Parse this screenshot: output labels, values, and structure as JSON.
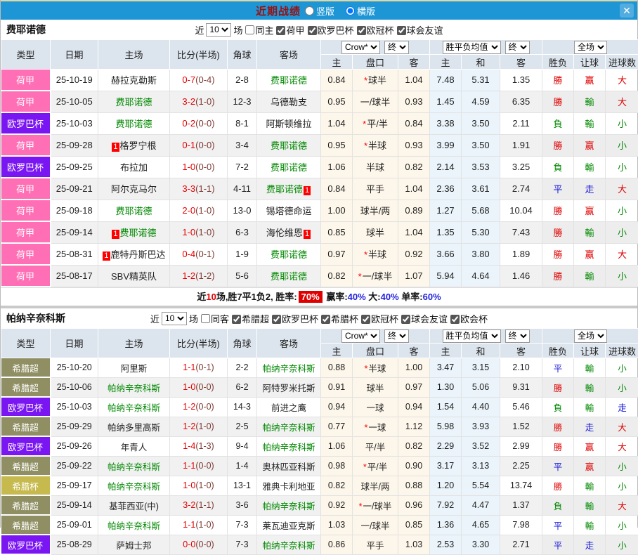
{
  "topbar": {
    "title": "近期战绩",
    "radio_vertical": "竖版",
    "radio_horizontal": "横版",
    "close": "✕"
  },
  "mark_text": "1",
  "type_colors": {
    "荷甲": "#ff6fb5",
    "欧罗巴杯": "#7a16f2",
    "希腊超": "#8f8f63",
    "希腊杯": "#c6ba4e"
  },
  "table_header": {
    "type": "类型",
    "date": "日期",
    "home": "主场",
    "score": "比分(半场)",
    "corner": "角球",
    "away": "客场",
    "odds_source": "Crow*",
    "final1": "终",
    "avg_label": "胜平负均值",
    "final2": "终",
    "fullmatch": "全场",
    "sub": {
      "home": "主",
      "handicap": "盘口",
      "away": "客",
      "avg_home": "主",
      "avg_draw": "和",
      "avg_away": "客",
      "wdl": "胜负",
      "let": "让球",
      "goals": "进球数"
    }
  },
  "sections": [
    {
      "team": "费耶诺德",
      "filters": {
        "near": "近",
        "count": "10",
        "unit": "场",
        "same": "同主",
        "same_checked": false,
        "leagues": [
          "荷甲",
          "欧罗巴杯",
          "欧冠杯",
          "球会友谊"
        ]
      },
      "rows": [
        {
          "lg": "荷甲",
          "d": "25-10-19",
          "h": "赫拉克勒斯",
          "hg": 0,
          "hm": 0,
          "ft": "0-7",
          "ht": "(0-4)",
          "cr": "2-8",
          "a": "费耶诺德",
          "ag": 1,
          "am": 0,
          "o1": "0.84",
          "st": 1,
          "hc": "球半",
          "o2": "1.04",
          "m1": "7.48",
          "m2": "5.31",
          "m3": "1.35",
          "r1": [
            "勝",
            "r"
          ],
          "r2": [
            "赢",
            "r"
          ],
          "r3": [
            "大",
            "r"
          ]
        },
        {
          "lg": "荷甲",
          "d": "25-10-05",
          "h": "费耶诺德",
          "hg": 1,
          "hm": 0,
          "ft": "3-2",
          "ht": "(1-0)",
          "cr": "12-3",
          "a": "乌德勒支",
          "ag": 0,
          "am": 0,
          "o1": "0.95",
          "st": 0,
          "hc": "一/球半",
          "o2": "0.93",
          "m1": "1.45",
          "m2": "4.59",
          "m3": "6.35",
          "r1": [
            "勝",
            "r"
          ],
          "r2": [
            "輸",
            "g"
          ],
          "r3": [
            "大",
            "r"
          ]
        },
        {
          "lg": "欧罗巴杯",
          "d": "25-10-03",
          "h": "费耶诺德",
          "hg": 1,
          "hm": 0,
          "ft": "0-2",
          "ht": "(0-0)",
          "cr": "8-1",
          "a": "阿斯顿维拉",
          "ag": 0,
          "am": 0,
          "o1": "1.04",
          "st": 1,
          "hc": "平/半",
          "o2": "0.84",
          "m1": "3.38",
          "m2": "3.50",
          "m3": "2.11",
          "r1": [
            "負",
            "g"
          ],
          "r2": [
            "輸",
            "g"
          ],
          "r3": [
            "小",
            "g"
          ]
        },
        {
          "lg": "荷甲",
          "d": "25-09-28",
          "h": "格罗宁根",
          "hg": 0,
          "hm": 1,
          "ft": "0-1",
          "ht": "(0-0)",
          "cr": "3-4",
          "a": "费耶诺德",
          "ag": 1,
          "am": 0,
          "o1": "0.95",
          "st": 1,
          "hc": "半球",
          "o2": "0.93",
          "m1": "3.99",
          "m2": "3.50",
          "m3": "1.91",
          "r1": [
            "勝",
            "r"
          ],
          "r2": [
            "赢",
            "r"
          ],
          "r3": [
            "小",
            "g"
          ]
        },
        {
          "lg": "欧罗巴杯",
          "d": "25-09-25",
          "h": "布拉加",
          "hg": 0,
          "hm": 0,
          "ft": "1-0",
          "ht": "(0-0)",
          "cr": "7-2",
          "a": "费耶诺德",
          "ag": 1,
          "am": 0,
          "o1": "1.06",
          "st": 0,
          "hc": "半球",
          "o2": "0.82",
          "m1": "2.14",
          "m2": "3.53",
          "m3": "3.25",
          "r1": [
            "負",
            "g"
          ],
          "r2": [
            "輸",
            "g"
          ],
          "r3": [
            "小",
            "g"
          ]
        },
        {
          "lg": "荷甲",
          "d": "25-09-21",
          "h": "阿尔克马尔",
          "hg": 0,
          "hm": 0,
          "ft": "3-3",
          "ht": "(1-1)",
          "cr": "4-11",
          "a": "费耶诺德",
          "ag": 1,
          "am": 1,
          "o1": "0.84",
          "st": 0,
          "hc": "平手",
          "o2": "1.04",
          "m1": "2.36",
          "m2": "3.61",
          "m3": "2.74",
          "r1": [
            "平",
            "b"
          ],
          "r2": [
            "走",
            "b"
          ],
          "r3": [
            "大",
            "r"
          ]
        },
        {
          "lg": "荷甲",
          "d": "25-09-18",
          "h": "费耶诺德",
          "hg": 1,
          "hm": 0,
          "ft": "2-0",
          "ht": "(1-0)",
          "cr": "13-0",
          "a": "锡塔德命运",
          "ag": 0,
          "am": 0,
          "o1": "1.00",
          "st": 0,
          "hc": "球半/两",
          "o2": "0.89",
          "m1": "1.27",
          "m2": "5.68",
          "m3": "10.04",
          "r1": [
            "勝",
            "r"
          ],
          "r2": [
            "赢",
            "r"
          ],
          "r3": [
            "小",
            "g"
          ]
        },
        {
          "lg": "荷甲",
          "d": "25-09-14",
          "h": "费耶诺德",
          "hg": 1,
          "hm": 1,
          "ft": "1-0",
          "ht": "(1-0)",
          "cr": "6-3",
          "a": "海伦维恩",
          "ag": 0,
          "am": 1,
          "o1": "0.85",
          "st": 0,
          "hc": "球半",
          "o2": "1.04",
          "m1": "1.35",
          "m2": "5.30",
          "m3": "7.43",
          "r1": [
            "勝",
            "r"
          ],
          "r2": [
            "輸",
            "g"
          ],
          "r3": [
            "小",
            "g"
          ]
        },
        {
          "lg": "荷甲",
          "d": "25-08-31",
          "h": "鹿特丹斯巴达",
          "hg": 0,
          "hm": 1,
          "ft": "0-4",
          "ht": "(0-1)",
          "cr": "1-9",
          "a": "费耶诺德",
          "ag": 1,
          "am": 0,
          "o1": "0.97",
          "st": 1,
          "hc": "半球",
          "o2": "0.92",
          "m1": "3.66",
          "m2": "3.80",
          "m3": "1.89",
          "r1": [
            "勝",
            "r"
          ],
          "r2": [
            "赢",
            "r"
          ],
          "r3": [
            "大",
            "r"
          ]
        },
        {
          "lg": "荷甲",
          "d": "25-08-17",
          "h": "SBV精英队",
          "hg": 0,
          "hm": 0,
          "ft": "1-2",
          "ht": "(1-2)",
          "cr": "5-6",
          "a": "费耶诺德",
          "ag": 1,
          "am": 0,
          "o1": "0.82",
          "st": 1,
          "hc": "一/球半",
          "o2": "1.07",
          "m1": "5.94",
          "m2": "4.64",
          "m3": "1.46",
          "r1": [
            "勝",
            "r"
          ],
          "r2": [
            "輸",
            "g"
          ],
          "r3": [
            "小",
            "g"
          ]
        }
      ],
      "summary": [
        {
          "text": "近",
          "style": "k"
        },
        {
          "text": "10",
          "style": "r"
        },
        {
          "text": "场,胜7平1负2, 胜率:",
          "style": "k"
        },
        {
          "text": "70%",
          "style": "rb"
        },
        {
          "text": " 赢率:",
          "style": "k"
        },
        {
          "text": "40%",
          "style": "b"
        },
        {
          "text": " 大:",
          "style": "k"
        },
        {
          "text": "40%",
          "style": "b"
        },
        {
          "text": " 单率:",
          "style": "k"
        },
        {
          "text": "60%",
          "style": "b"
        }
      ]
    },
    {
      "team": "帕纳辛奈科斯",
      "filters": {
        "near": "近",
        "count": "10",
        "unit": "场",
        "same": "同客",
        "same_checked": false,
        "leagues": [
          "希腊超",
          "欧罗巴杯",
          "希腊杯",
          "欧冠杯",
          "球会友谊",
          "欧会杯"
        ]
      },
      "rows": [
        {
          "lg": "希腊超",
          "d": "25-10-20",
          "h": "阿里斯",
          "hg": 0,
          "hm": 0,
          "ft": "1-1",
          "ht": "(0-1)",
          "cr": "2-2",
          "a": "帕纳辛奈科斯",
          "ag": 1,
          "am": 0,
          "o1": "0.88",
          "st": 1,
          "hc": "半球",
          "o2": "1.00",
          "m1": "3.47",
          "m2": "3.15",
          "m3": "2.10",
          "r1": [
            "平",
            "b"
          ],
          "r2": [
            "輸",
            "g"
          ],
          "r3": [
            "小",
            "g"
          ]
        },
        {
          "lg": "希腊超",
          "d": "25-10-06",
          "h": "帕纳辛奈科斯",
          "hg": 1,
          "hm": 0,
          "ft": "1-0",
          "ht": "(0-0)",
          "cr": "6-2",
          "a": "阿特罗米托斯",
          "ag": 0,
          "am": 0,
          "o1": "0.91",
          "st": 0,
          "hc": "球半",
          "o2": "0.97",
          "m1": "1.30",
          "m2": "5.06",
          "m3": "9.31",
          "r1": [
            "勝",
            "r"
          ],
          "r2": [
            "輸",
            "g"
          ],
          "r3": [
            "小",
            "g"
          ]
        },
        {
          "lg": "欧罗巴杯",
          "d": "25-10-03",
          "h": "帕纳辛奈科斯",
          "hg": 1,
          "hm": 0,
          "ft": "1-2",
          "ht": "(0-0)",
          "cr": "14-3",
          "a": "前进之鹰",
          "ag": 0,
          "am": 0,
          "o1": "0.94",
          "st": 0,
          "hc": "一球",
          "o2": "0.94",
          "m1": "1.54",
          "m2": "4.40",
          "m3": "5.46",
          "r1": [
            "負",
            "g"
          ],
          "r2": [
            "輸",
            "g"
          ],
          "r3": [
            "走",
            "b"
          ]
        },
        {
          "lg": "希腊超",
          "d": "25-09-29",
          "h": "帕纳多里高斯",
          "hg": 0,
          "hm": 0,
          "ft": "1-2",
          "ht": "(1-0)",
          "cr": "2-5",
          "a": "帕纳辛奈科斯",
          "ag": 1,
          "am": 0,
          "o1": "0.77",
          "st": 1,
          "hc": "一球",
          "o2": "1.12",
          "m1": "5.98",
          "m2": "3.93",
          "m3": "1.52",
          "r1": [
            "勝",
            "r"
          ],
          "r2": [
            "走",
            "b"
          ],
          "r3": [
            "大",
            "r"
          ]
        },
        {
          "lg": "欧罗巴杯",
          "d": "25-09-26",
          "h": "年青人",
          "hg": 0,
          "hm": 0,
          "ft": "1-4",
          "ht": "(1-3)",
          "cr": "9-4",
          "a": "帕纳辛奈科斯",
          "ag": 1,
          "am": 0,
          "o1": "1.06",
          "st": 0,
          "hc": "平/半",
          "o2": "0.82",
          "m1": "2.29",
          "m2": "3.52",
          "m3": "2.99",
          "r1": [
            "勝",
            "r"
          ],
          "r2": [
            "赢",
            "r"
          ],
          "r3": [
            "大",
            "r"
          ]
        },
        {
          "lg": "希腊超",
          "d": "25-09-22",
          "h": "帕纳辛奈科斯",
          "hg": 1,
          "hm": 0,
          "ft": "1-1",
          "ht": "(0-0)",
          "cr": "1-4",
          "a": "奥林匹亚科斯",
          "ag": 0,
          "am": 0,
          "o1": "0.98",
          "st": 1,
          "hc": "平/半",
          "o2": "0.90",
          "m1": "3.17",
          "m2": "3.13",
          "m3": "2.25",
          "r1": [
            "平",
            "b"
          ],
          "r2": [
            "赢",
            "r"
          ],
          "r3": [
            "小",
            "g"
          ]
        },
        {
          "lg": "希腊杯",
          "d": "25-09-17",
          "h": "帕纳辛奈科斯",
          "hg": 1,
          "hm": 0,
          "ft": "1-0",
          "ht": "(1-0)",
          "cr": "13-1",
          "a": "雅典卡利地亚",
          "ag": 0,
          "am": 0,
          "o1": "0.82",
          "st": 0,
          "hc": "球半/两",
          "o2": "0.88",
          "m1": "1.20",
          "m2": "5.54",
          "m3": "13.74",
          "r1": [
            "勝",
            "r"
          ],
          "r2": [
            "輸",
            "g"
          ],
          "r3": [
            "小",
            "g"
          ]
        },
        {
          "lg": "希腊超",
          "d": "25-09-14",
          "h": "基菲西亚(中)",
          "hg": 0,
          "hm": 0,
          "ft": "3-2",
          "ht": "(1-1)",
          "cr": "3-6",
          "a": "帕纳辛奈科斯",
          "ag": 1,
          "am": 0,
          "o1": "0.92",
          "st": 1,
          "hc": "一/球半",
          "o2": "0.96",
          "m1": "7.92",
          "m2": "4.47",
          "m3": "1.37",
          "r1": [
            "負",
            "g"
          ],
          "r2": [
            "輸",
            "g"
          ],
          "r3": [
            "大",
            "r"
          ]
        },
        {
          "lg": "希腊超",
          "d": "25-09-01",
          "h": "帕纳辛奈科斯",
          "hg": 1,
          "hm": 0,
          "ft": "1-1",
          "ht": "(1-0)",
          "cr": "7-3",
          "a": "莱瓦迪亚克斯",
          "ag": 0,
          "am": 0,
          "o1": "1.03",
          "st": 0,
          "hc": "一/球半",
          "o2": "0.85",
          "m1": "1.36",
          "m2": "4.65",
          "m3": "7.98",
          "r1": [
            "平",
            "b"
          ],
          "r2": [
            "輸",
            "g"
          ],
          "r3": [
            "小",
            "g"
          ]
        },
        {
          "lg": "欧罗巴杯",
          "d": "25-08-29",
          "h": "萨姆士邦",
          "hg": 0,
          "hm": 0,
          "ft": "0-0",
          "ht": "(0-0)",
          "cr": "7-3",
          "a": "帕纳辛奈科斯",
          "ag": 1,
          "am": 0,
          "o1": "0.86",
          "st": 0,
          "hc": "平手",
          "o2": "1.03",
          "m1": "2.53",
          "m2": "3.30",
          "m3": "2.71",
          "r1": [
            "平",
            "b"
          ],
          "r2": [
            "走",
            "b"
          ],
          "r3": [
            "小",
            "g"
          ]
        }
      ]
    }
  ]
}
